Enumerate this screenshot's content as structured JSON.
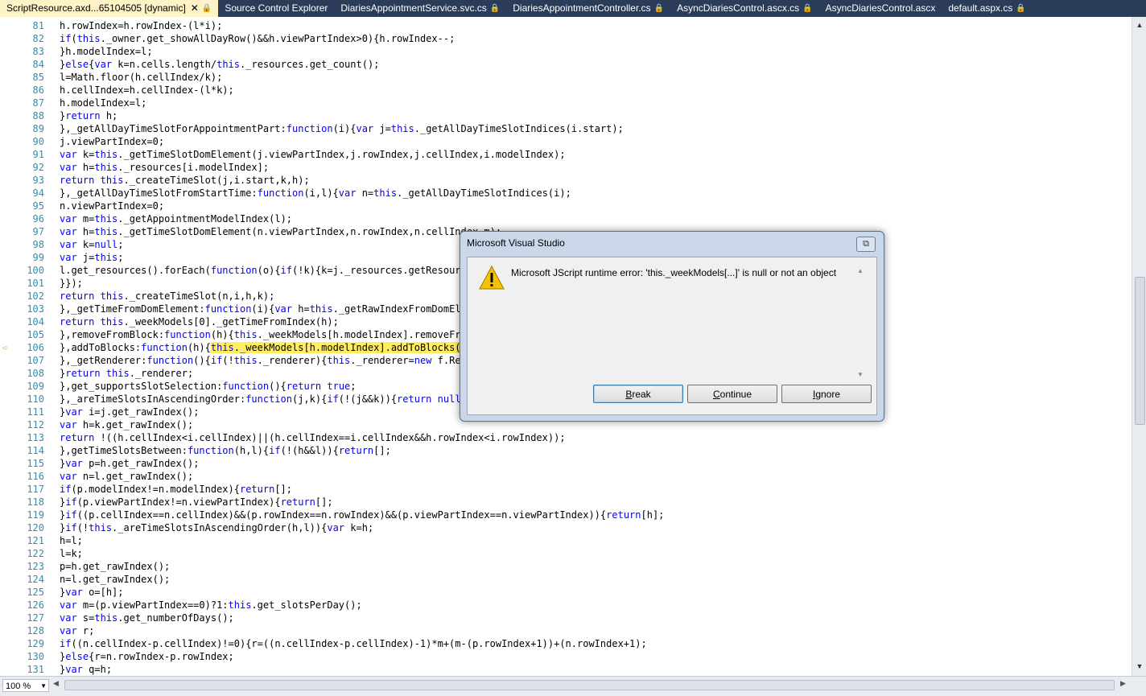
{
  "tabs": [
    {
      "label": "ScriptResource.axd...65104505 [dynamic]",
      "lock": true,
      "close": true,
      "active": true
    },
    {
      "label": "Source Control Explorer",
      "lock": false,
      "close": false,
      "active": false
    },
    {
      "label": "DiariesAppointmentService.svc.cs",
      "lock": true,
      "close": false,
      "active": false
    },
    {
      "label": "DiariesAppointmentController.cs",
      "lock": true,
      "close": false,
      "active": false
    },
    {
      "label": "AsyncDiariesControl.ascx.cs",
      "lock": true,
      "close": false,
      "active": false
    },
    {
      "label": "AsyncDiariesControl.ascx",
      "lock": false,
      "close": false,
      "active": false
    },
    {
      "label": "default.aspx.cs",
      "lock": true,
      "close": false,
      "active": false
    }
  ],
  "code_lines": [
    {
      "n": "81",
      "t": "h.rowIndex=h.rowIndex-(l*i);"
    },
    {
      "n": "82",
      "t": "if(this._owner.get_showAllDayRow()&&h.viewPartIndex>0){h.rowIndex--;"
    },
    {
      "n": "83",
      "t": "}h.modelIndex=l;"
    },
    {
      "n": "84",
      "t": "}else{var k=n.cells.length/this._resources.get_count();"
    },
    {
      "n": "85",
      "t": "l=Math.floor(h.cellIndex/k);"
    },
    {
      "n": "86",
      "t": "h.cellIndex=h.cellIndex-(l*k);"
    },
    {
      "n": "87",
      "t": "h.modelIndex=l;"
    },
    {
      "n": "88",
      "t": "}return h;"
    },
    {
      "n": "89",
      "t": "},_getAllDayTimeSlotForAppointmentPart:function(i){var j=this._getAllDayTimeSlotIndices(i.start);"
    },
    {
      "n": "90",
      "t": "j.viewPartIndex=0;"
    },
    {
      "n": "91",
      "t": "var k=this._getTimeSlotDomElement(j.viewPartIndex,j.rowIndex,j.cellIndex,i.modelIndex);"
    },
    {
      "n": "92",
      "t": "var h=this._resources[i.modelIndex];"
    },
    {
      "n": "93",
      "t": "return this._createTimeSlot(j,i.start,k,h);"
    },
    {
      "n": "94",
      "t": "},_getAllDayTimeSlotFromStartTime:function(i,l){var n=this._getAllDayTimeSlotIndices(i);"
    },
    {
      "n": "95",
      "t": "n.viewPartIndex=0;"
    },
    {
      "n": "96",
      "t": "var m=this._getAppointmentModelIndex(l);"
    },
    {
      "n": "97",
      "t": "var h=this._getTimeSlotDomElement(n.viewPartIndex,n.rowIndex,n.cellIndex,m);"
    },
    {
      "n": "98",
      "t": "var k=null;"
    },
    {
      "n": "99",
      "t": "var j=this;"
    },
    {
      "n": "100",
      "t": "l.get_resources().forEach(function(o){if(!k){k=j._resources.getResource"
    },
    {
      "n": "101",
      "t": "}});"
    },
    {
      "n": "102",
      "t": "return this._createTimeSlot(n,i,h,k);"
    },
    {
      "n": "103",
      "t": "},_getTimeFromDomElement:function(i){var h=this._getRawIndexFromDomElem"
    },
    {
      "n": "104",
      "t": "return this._weekModels[0]._getTimeFromIndex(h);"
    },
    {
      "n": "105",
      "t": "},removeFromBlock:function(h){this._weekModels[h.modelIndex].removeFrom"
    },
    {
      "n": "106",
      "t": "},addToBlocks:function(h){",
      "hl": "this._weekModels[h.modelIndex].addToBlocks(h)",
      "current": true
    },
    {
      "n": "107",
      "t": "},_getRenderer:function(){if(!this._renderer){this._renderer=new f.Rend"
    },
    {
      "n": "108",
      "t": "}return this._renderer;"
    },
    {
      "n": "109",
      "t": "},get_supportsSlotSelection:function(){return true;"
    },
    {
      "n": "110",
      "t": "},_areTimeSlotsInAscendingOrder:function(j,k){if(!(j&&k)){return null;"
    },
    {
      "n": "111",
      "t": "}var i=j.get_rawIndex();"
    },
    {
      "n": "112",
      "t": "var h=k.get_rawIndex();"
    },
    {
      "n": "113",
      "t": "return !((h.cellIndex<i.cellIndex)||(h.cellIndex==i.cellIndex&&h.rowIndex<i.rowIndex));"
    },
    {
      "n": "114",
      "t": "},getTimeSlotsBetween:function(h,l){if(!(h&&l)){return[];"
    },
    {
      "n": "115",
      "t": "}var p=h.get_rawIndex();"
    },
    {
      "n": "116",
      "t": "var n=l.get_rawIndex();"
    },
    {
      "n": "117",
      "t": "if(p.modelIndex!=n.modelIndex){return[];"
    },
    {
      "n": "118",
      "t": "}if(p.viewPartIndex!=n.viewPartIndex){return[];"
    },
    {
      "n": "119",
      "t": "}if((p.cellIndex==n.cellIndex)&&(p.rowIndex==n.rowIndex)&&(p.viewPartIndex==n.viewPartIndex)){return[h];"
    },
    {
      "n": "120",
      "t": "}if(!this._areTimeSlotsInAscendingOrder(h,l)){var k=h;"
    },
    {
      "n": "121",
      "t": "h=l;"
    },
    {
      "n": "122",
      "t": "l=k;"
    },
    {
      "n": "123",
      "t": "p=h.get_rawIndex();"
    },
    {
      "n": "124",
      "t": "n=l.get_rawIndex();"
    },
    {
      "n": "125",
      "t": "}var o=[h];"
    },
    {
      "n": "126",
      "t": "var m=(p.viewPartIndex==0)?1:this.get_slotsPerDay();"
    },
    {
      "n": "127",
      "t": "var s=this.get_numberOfDays();"
    },
    {
      "n": "128",
      "t": "var r;"
    },
    {
      "n": "129",
      "t": "if((n.cellIndex-p.cellIndex)!=0){r=((n.cellIndex-p.cellIndex)-1)*m+(m-(p.rowIndex+1))+(n.rowIndex+1);"
    },
    {
      "n": "130",
      "t": "}else{r=n.rowIndex-p.rowIndex;"
    },
    {
      "n": "131",
      "t": "}var q=h;"
    }
  ],
  "zoom": "100 %",
  "dialog": {
    "title": "Microsoft Visual Studio",
    "message": "Microsoft JScript runtime error: 'this._weekModels[...]' is null or not an object",
    "icon": "warning-icon",
    "buttons": {
      "break_prefix": "",
      "break_ul": "B",
      "break_rest": "reak",
      "continue_prefix": "",
      "continue_ul": "C",
      "continue_rest": "ontinue",
      "ignore_prefix": "",
      "ignore_ul": "I",
      "ignore_rest": "gnore"
    }
  },
  "colors": {
    "keyword": "#0000ff",
    "line_number": "#2b91af",
    "highlight": "#ffee62",
    "tab_bar": "#2b3c59",
    "active_tab": "#fdf3c6"
  }
}
